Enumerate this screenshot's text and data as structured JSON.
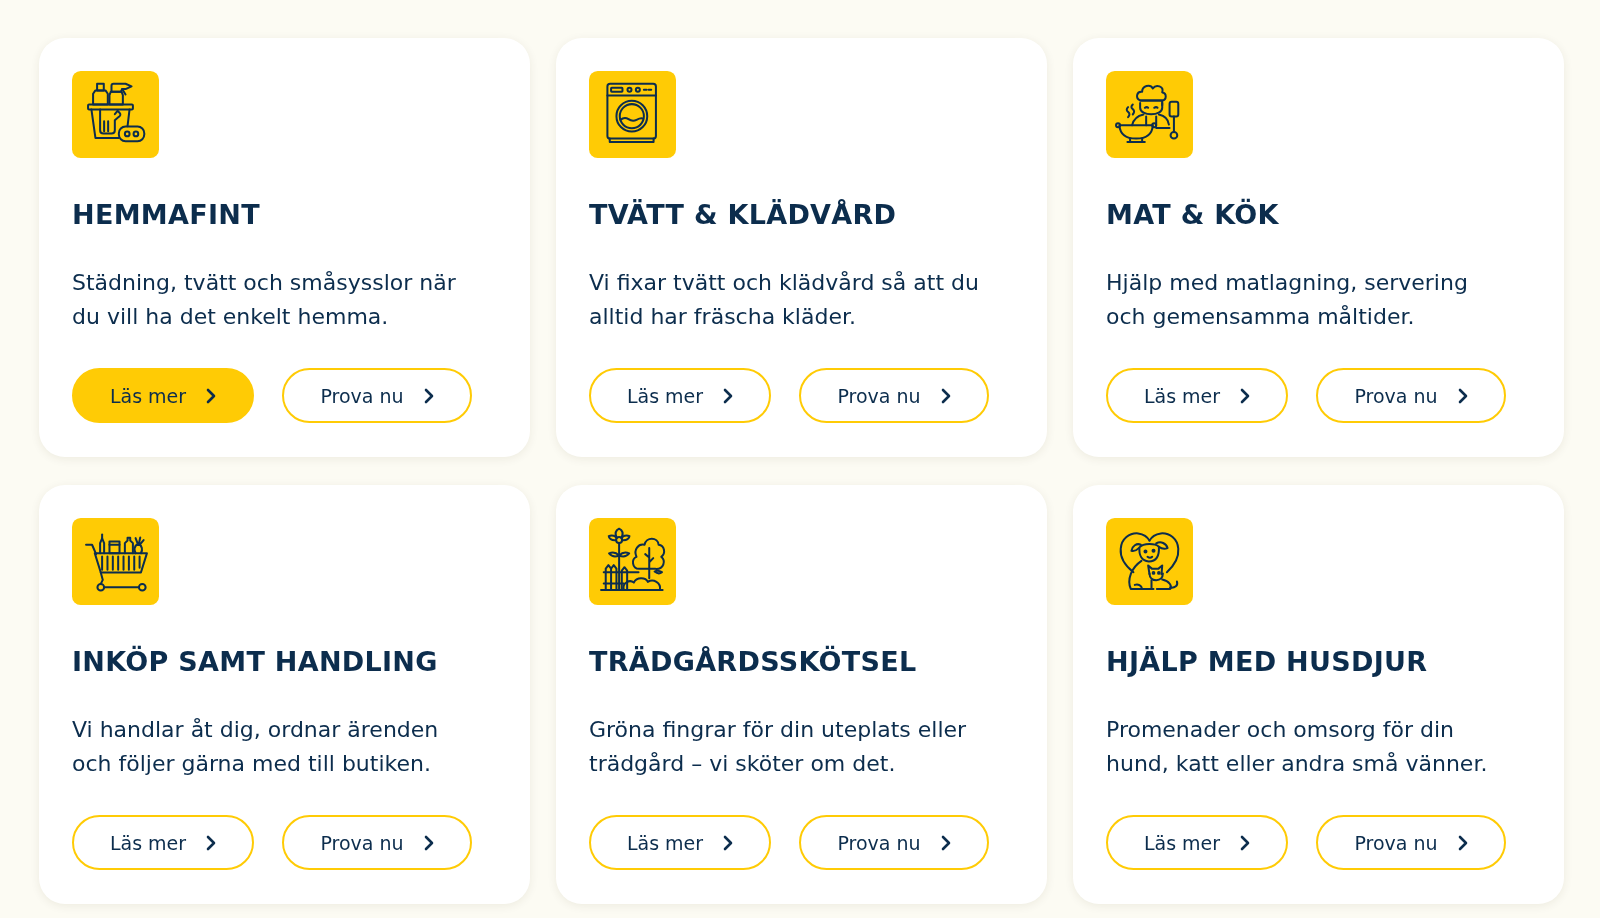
{
  "cards": [
    {
      "title": "HEMMAFINT",
      "description": "Städning, tvätt och småsysslor när du vill ha det enkelt hemma.",
      "buttons": [
        {
          "label": "Läs mer",
          "filled": true
        },
        {
          "label": "Prova nu",
          "filled": false
        }
      ]
    },
    {
      "title": "TVÄTT & KLÄDVÅRD",
      "description": "Vi fixar tvätt och klädvård så att du alltid har fräscha kläder.",
      "buttons": [
        {
          "label": "Läs mer",
          "filled": false
        },
        {
          "label": "Prova nu",
          "filled": false
        }
      ]
    },
    {
      "title": "MAT & KÖK",
      "description": "Hjälp med matlagning, servering och gemensamma måltider.",
      "buttons": [
        {
          "label": "Läs mer",
          "filled": false
        },
        {
          "label": "Prova nu",
          "filled": false
        }
      ]
    },
    {
      "title": "INKÖP SAMT HANDLING",
      "description": "Vi handlar åt dig, ordnar ärenden och följer gärna med till butiken.",
      "buttons": [
        {
          "label": "Läs mer",
          "filled": false
        },
        {
          "label": "Prova nu",
          "filled": false
        }
      ]
    },
    {
      "title": "TRÄDGÅRDSSKÖTSEL",
      "description": "Gröna fingrar för din uteplats eller trädgård – vi sköter om det.",
      "buttons": [
        {
          "label": "Läs mer",
          "filled": false
        },
        {
          "label": "Prova nu",
          "filled": false
        }
      ]
    },
    {
      "title": "HJÄLP MED HUSDJUR",
      "description": "Promenader och omsorg för din hund, katt eller andra små vänner.",
      "buttons": [
        {
          "label": "Läs mer",
          "filled": false
        },
        {
          "label": "Prova nu",
          "filled": false
        }
      ]
    }
  ]
}
